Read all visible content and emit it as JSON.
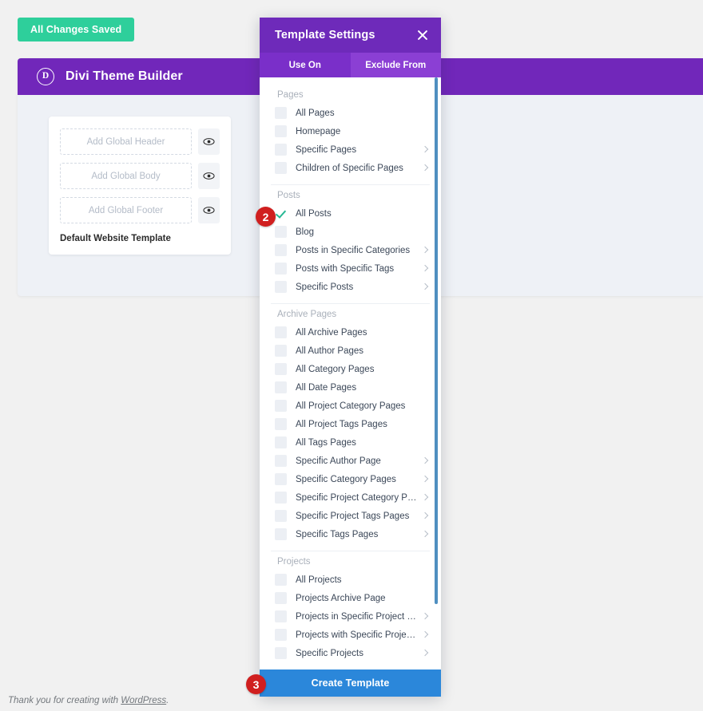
{
  "save_status": {
    "label": "All Changes Saved"
  },
  "builder": {
    "logo_letter": "D",
    "title": "Divi Theme Builder",
    "template_card": {
      "slots": [
        {
          "label": "Add Global Header",
          "visibility_icon": "eye-icon"
        },
        {
          "label": "Add Global Body",
          "visibility_icon": "eye-icon"
        },
        {
          "label": "Add Global Footer",
          "visibility_icon": "eye-icon"
        }
      ],
      "name": "Default Website Template"
    }
  },
  "footer": {
    "prefix": "Thank you for creating with ",
    "link": "WordPress",
    "suffix": "."
  },
  "modal": {
    "title": "Template Settings",
    "close_icon": "close-icon",
    "tabs": [
      {
        "label": "Use On",
        "active": true
      },
      {
        "label": "Exclude From",
        "active": false
      }
    ],
    "groups": [
      {
        "title": "Pages",
        "options": [
          {
            "label": "All Pages",
            "checked": false,
            "has_chevron": false
          },
          {
            "label": "Homepage",
            "checked": false,
            "has_chevron": false
          },
          {
            "label": "Specific Pages",
            "checked": false,
            "has_chevron": true
          },
          {
            "label": "Children of Specific Pages",
            "checked": false,
            "has_chevron": true
          }
        ]
      },
      {
        "title": "Posts",
        "options": [
          {
            "label": "All Posts",
            "checked": true,
            "has_chevron": false
          },
          {
            "label": "Blog",
            "checked": false,
            "has_chevron": false
          },
          {
            "label": "Posts in Specific Categories",
            "checked": false,
            "has_chevron": true
          },
          {
            "label": "Posts with Specific Tags",
            "checked": false,
            "has_chevron": true
          },
          {
            "label": "Specific Posts",
            "checked": false,
            "has_chevron": true
          }
        ]
      },
      {
        "title": "Archive Pages",
        "options": [
          {
            "label": "All Archive Pages",
            "checked": false,
            "has_chevron": false
          },
          {
            "label": "All Author Pages",
            "checked": false,
            "has_chevron": false
          },
          {
            "label": "All Category Pages",
            "checked": false,
            "has_chevron": false
          },
          {
            "label": "All Date Pages",
            "checked": false,
            "has_chevron": false
          },
          {
            "label": "All Project Category Pages",
            "checked": false,
            "has_chevron": false
          },
          {
            "label": "All Project Tags Pages",
            "checked": false,
            "has_chevron": false
          },
          {
            "label": "All Tags Pages",
            "checked": false,
            "has_chevron": false
          },
          {
            "label": "Specific Author Page",
            "checked": false,
            "has_chevron": true
          },
          {
            "label": "Specific Category Pages",
            "checked": false,
            "has_chevron": true
          },
          {
            "label": "Specific Project Category Pages",
            "checked": false,
            "has_chevron": true
          },
          {
            "label": "Specific Project Tags Pages",
            "checked": false,
            "has_chevron": true
          },
          {
            "label": "Specific Tags Pages",
            "checked": false,
            "has_chevron": true
          }
        ]
      },
      {
        "title": "Projects",
        "options": [
          {
            "label": "All Projects",
            "checked": false,
            "has_chevron": false
          },
          {
            "label": "Projects Archive Page",
            "checked": false,
            "has_chevron": false
          },
          {
            "label": "Projects in Specific Project Cate...",
            "checked": false,
            "has_chevron": true
          },
          {
            "label": "Projects with Specific Project T...",
            "checked": false,
            "has_chevron": true
          },
          {
            "label": "Specific Projects",
            "checked": false,
            "has_chevron": true
          }
        ]
      }
    ],
    "create_button": {
      "label": "Create Template"
    }
  },
  "step_badges": [
    {
      "number": "2"
    },
    {
      "number": "3"
    }
  ],
  "colors": {
    "saved_green": "#2ecf9b",
    "divi_purple": "#7127ba",
    "modal_purple": "#6e2aba",
    "tab_purple": "#8b3fd4",
    "create_blue": "#2b87da",
    "badge_red": "#d01f1f",
    "check_green": "#27b894"
  }
}
